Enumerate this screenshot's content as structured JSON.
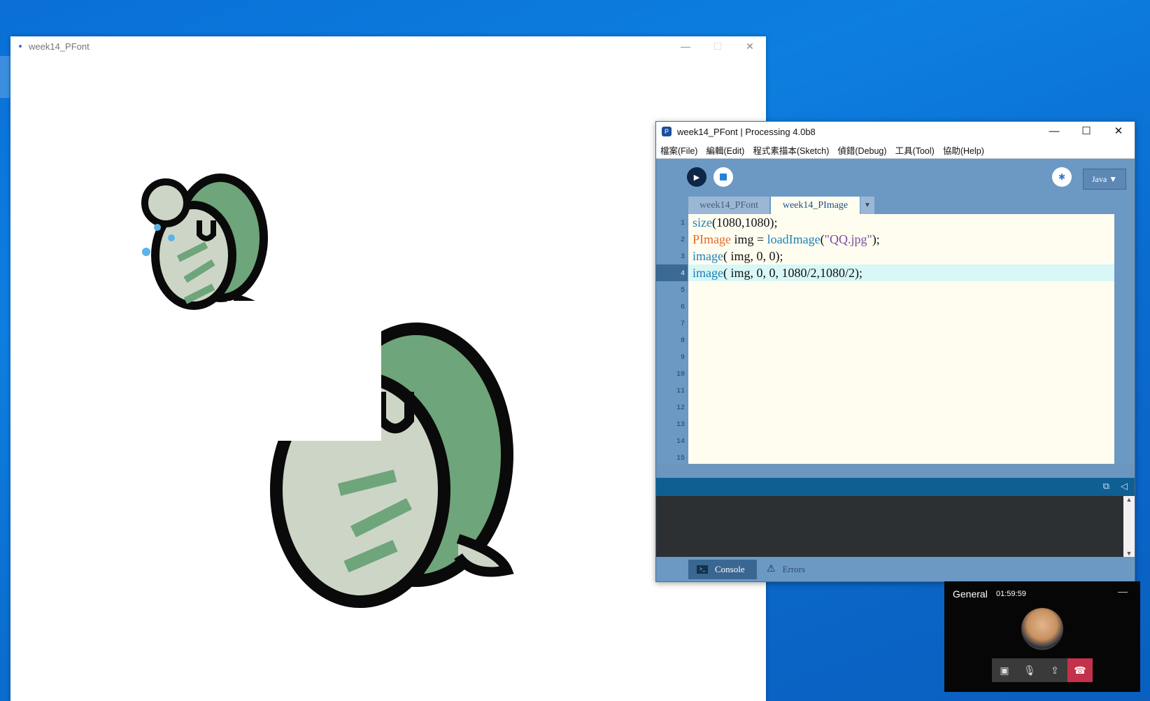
{
  "sketch_window": {
    "title": "week14_PFont"
  },
  "ide": {
    "title": "week14_PFont | Processing 4.0b8",
    "menu": [
      "檔案(File)",
      "編輯(Edit)",
      "程式素描本(Sketch)",
      "偵錯(Debug)",
      "工具(Tool)",
      "協助(Help)"
    ],
    "mode": "Java ▼",
    "tabs": [
      "week14_PFont",
      "week14_PImage"
    ],
    "active_tab": "week14_PImage",
    "line_numbers": [
      "1",
      "2",
      "3",
      "4",
      "5",
      "6",
      "7",
      "8",
      "9",
      "10",
      "11",
      "12",
      "13",
      "14",
      "15"
    ],
    "current_line": 4,
    "code": [
      {
        "fn": "size",
        "rest": "(1080,1080);"
      },
      {
        "type": "PImage",
        "mid": " img = ",
        "fn": "loadImage",
        "open": "(",
        "str": "\"QQ.jpg\"",
        "rest": ");"
      },
      {
        "fn": "image",
        "rest": "( img, 0, 0);"
      },
      {
        "fn": "image",
        "rest": "( img, 0, 0, 1080/2,1080/2);"
      }
    ],
    "footer": {
      "console_label": "Console",
      "errors_label": "Errors"
    }
  },
  "call": {
    "channel": "General",
    "duration": "01:59:59"
  },
  "icons": {
    "run": "play-icon",
    "stop": "stop-icon",
    "debug": "debug-icon"
  }
}
